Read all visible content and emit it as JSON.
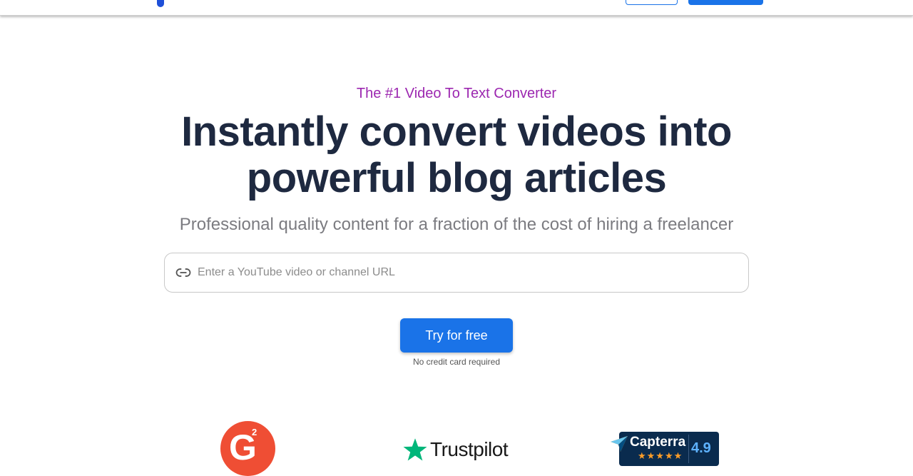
{
  "hero": {
    "eyebrow": "The #1 Video To Text Converter",
    "headline": "Instantly convert videos into powerful blog articles",
    "subheadline": "Professional quality content for a fraction of the cost of hiring a freelancer"
  },
  "url_input": {
    "placeholder": "Enter a YouTube video or channel URL",
    "value": ""
  },
  "cta": {
    "label": "Try for free",
    "note": "No credit card required"
  },
  "ratings": {
    "g2": {
      "letter": "G",
      "superscript": "2"
    },
    "trustpilot": {
      "name": "Trustpilot"
    },
    "capterra": {
      "name": "Capterra",
      "score": "4.9",
      "stars": "★★★★★"
    }
  },
  "colors": {
    "accent": "#1a73e8",
    "eyebrow": "#9c27b0",
    "headline": "#1e2940",
    "g2": "#ef4e34",
    "trustpilot_star": "#00b67a",
    "capterra_bg": "#0a2b4e"
  },
  "icons": [
    "link-icon",
    "trustpilot-star-icon",
    "capterra-flag-icon"
  ]
}
